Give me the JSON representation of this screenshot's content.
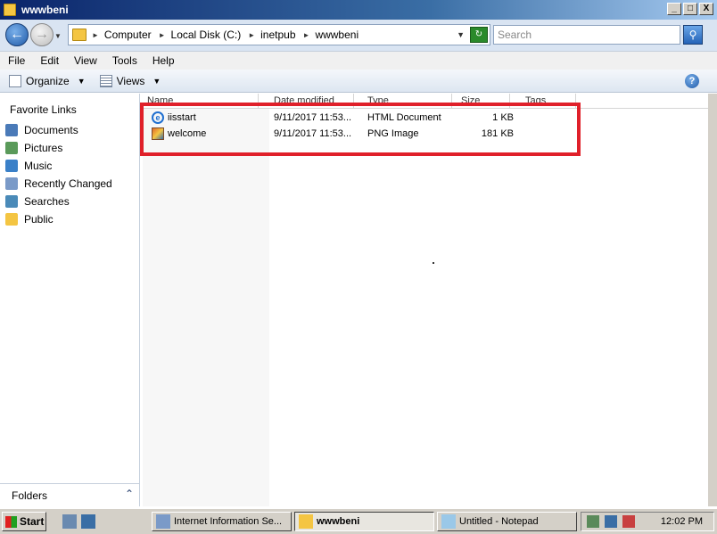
{
  "window": {
    "title": "wwwbeni",
    "buttons": {
      "minimize": "_",
      "maximize": "□",
      "close": "X"
    }
  },
  "address": {
    "crumbs": [
      "Computer",
      "Local Disk (C:)",
      "inetpub",
      "wwwbeni"
    ],
    "search_placeholder": "Search"
  },
  "menu": [
    "File",
    "Edit",
    "View",
    "Tools",
    "Help"
  ],
  "toolbar": {
    "organize": "Organize",
    "views": "Views"
  },
  "sidebar": {
    "title": "Favorite Links",
    "items": [
      {
        "label": "Documents",
        "icon": "documents-icon",
        "color": "#4a7ab8"
      },
      {
        "label": "Pictures",
        "icon": "pictures-icon",
        "color": "#5a9a5a"
      },
      {
        "label": "Music",
        "icon": "music-icon",
        "color": "#3a80c8"
      },
      {
        "label": "Recently Changed",
        "icon": "recent-icon",
        "color": "#7a9ac8"
      },
      {
        "label": "Searches",
        "icon": "searches-icon",
        "color": "#4a8ab8"
      },
      {
        "label": "Public",
        "icon": "public-folder-icon",
        "color": "#f4c542"
      }
    ],
    "folders_label": "Folders"
  },
  "columns": [
    "Name",
    "Date modified",
    "Type",
    "Size",
    "Tags"
  ],
  "files": [
    {
      "name": "iisstart",
      "date": "9/11/2017 11:53...",
      "type": "HTML Document",
      "size": "1 KB",
      "icon": "ie-html-icon"
    },
    {
      "name": "welcome",
      "date": "9/11/2017 11:53...",
      "type": "PNG Image",
      "size": "181 KB",
      "icon": "png-image-icon"
    }
  ],
  "taskbar": {
    "start": "Start",
    "tasks": [
      {
        "label": "Internet Information Se...",
        "active": false
      },
      {
        "label": "wwwbeni",
        "active": true
      },
      {
        "label": "Untitled - Notepad",
        "active": false
      }
    ],
    "clock": "12:02 PM"
  }
}
